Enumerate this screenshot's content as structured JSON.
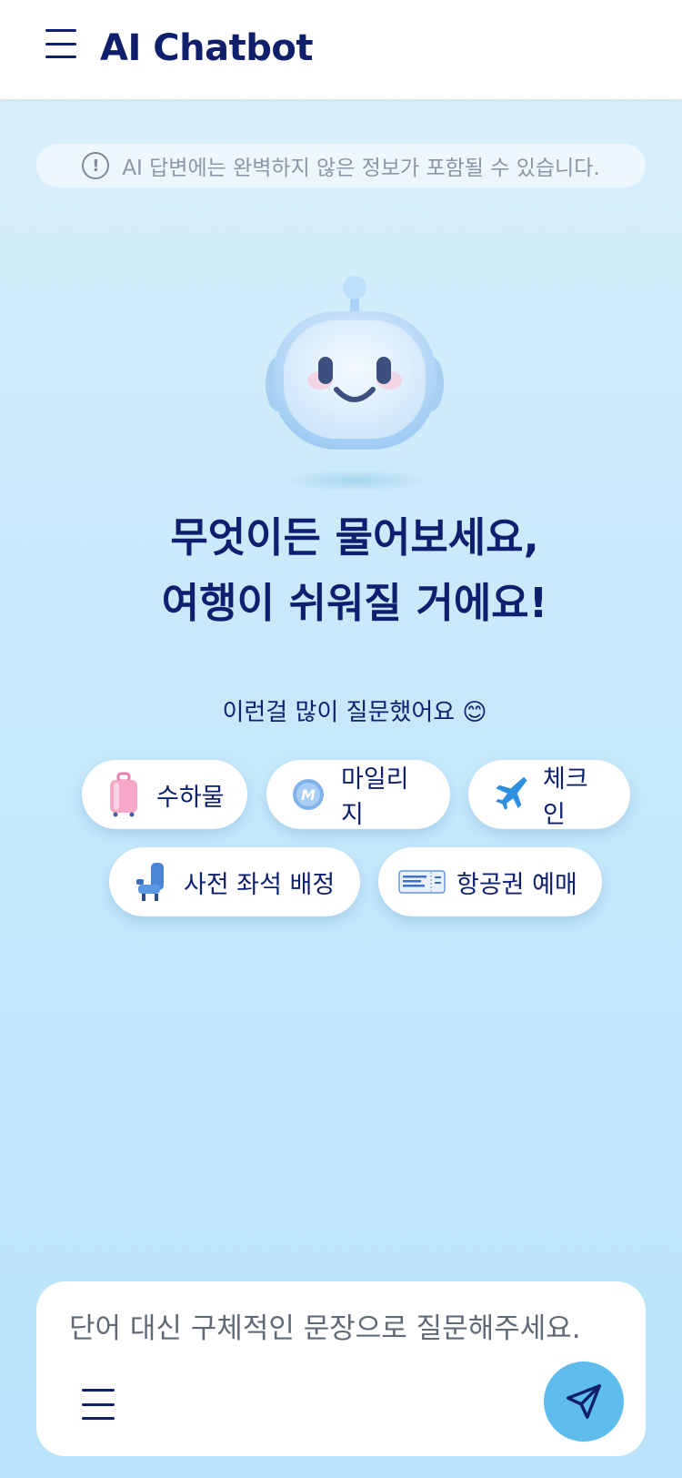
{
  "header": {
    "title": "AI Chatbot"
  },
  "notice": {
    "text": "AI 답변에는 완벽하지 않은 정보가 포함될 수 있습니다."
  },
  "hero": {
    "line1": "무엇이든 물어보세요,",
    "line2": "여행이 쉬워질 거에요!"
  },
  "suggestions": {
    "heading": "이런걸 많이 질문했어요 😊",
    "chips": [
      {
        "label": "수하물",
        "icon": "luggage-icon"
      },
      {
        "label": "마일리지",
        "icon": "mileage-coin-icon"
      },
      {
        "label": "체크인",
        "icon": "airplane-icon"
      },
      {
        "label": "사전 좌석 배정",
        "icon": "seat-icon"
      },
      {
        "label": "항공권 예매",
        "icon": "ticket-icon"
      }
    ]
  },
  "composer": {
    "placeholder": "단어 대신 구체적인 문장으로 질문해주세요."
  },
  "colors": {
    "navy": "#0f1f6b",
    "accent": "#5ebdec",
    "background": "#c9e9fb"
  }
}
